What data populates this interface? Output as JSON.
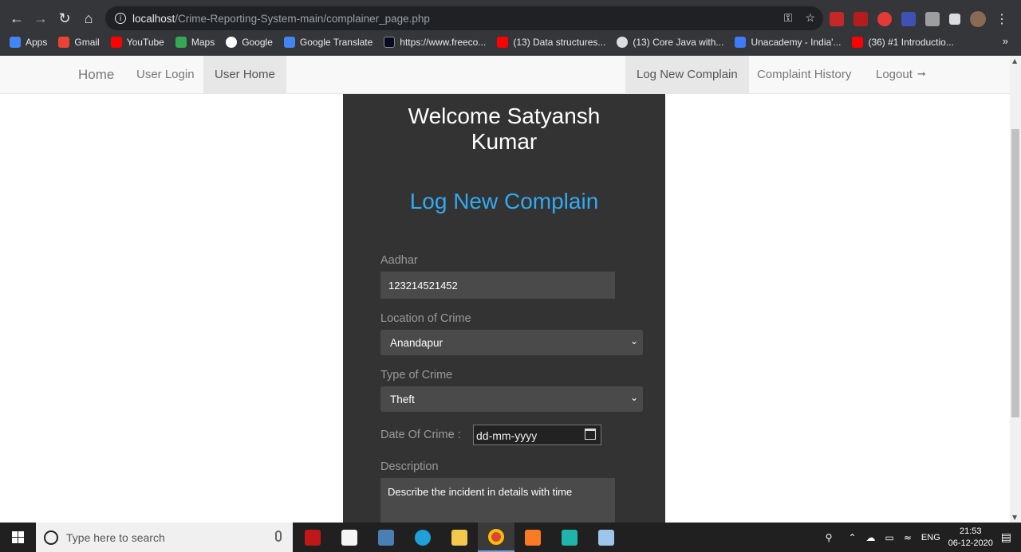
{
  "browser": {
    "url_host": "localhost",
    "url_path": "/Crime-Reporting-System-main/complainer_page.php",
    "bookmarks": [
      {
        "label": "Apps",
        "color": "#4285f4"
      },
      {
        "label": "Gmail",
        "color": "#ea4335"
      },
      {
        "label": "YouTube",
        "color": "#ff0000"
      },
      {
        "label": "Maps",
        "color": "#34a853"
      },
      {
        "label": "Google",
        "color": "#ffffff"
      },
      {
        "label": "Google Translate",
        "color": "#4285f4"
      },
      {
        "label": "https://www.freeco...",
        "color": "#0a0a23"
      },
      {
        "label": "(13) Data structures...",
        "color": "#ff0000"
      },
      {
        "label": "(13) Core Java with...",
        "color": "#dddddd"
      },
      {
        "label": "Unacademy - India'...",
        "color": "#3d7bf7"
      },
      {
        "label": "(36) #1 Introductio...",
        "color": "#ff0000"
      }
    ],
    "more_bookmarks": "»"
  },
  "nav": {
    "home": "Home",
    "user_login": "User Login",
    "user_home": "User Home",
    "log_new_complain": "Log New Complain",
    "complaint_history": "Complaint History",
    "logout": "Logout"
  },
  "panel": {
    "welcome_line1": "Welcome Satyansh",
    "welcome_line2": "Kumar",
    "title": "Log New Complain",
    "aadhar_label": "Aadhar",
    "aadhar_value": "123214521452",
    "location_label": "Location of Crime",
    "location_value": "Anandapur",
    "type_label": "Type of Crime",
    "type_value": "Theft",
    "date_label": "Date Of Crime :",
    "date_placeholder": "dd-mm-yyyy",
    "description_label": "Description",
    "description_placeholder": "Describe the incident in details with time"
  },
  "taskbar": {
    "search_placeholder": "Type here to search",
    "language": "ENG",
    "time": "21:53",
    "date": "06-12-2020"
  }
}
